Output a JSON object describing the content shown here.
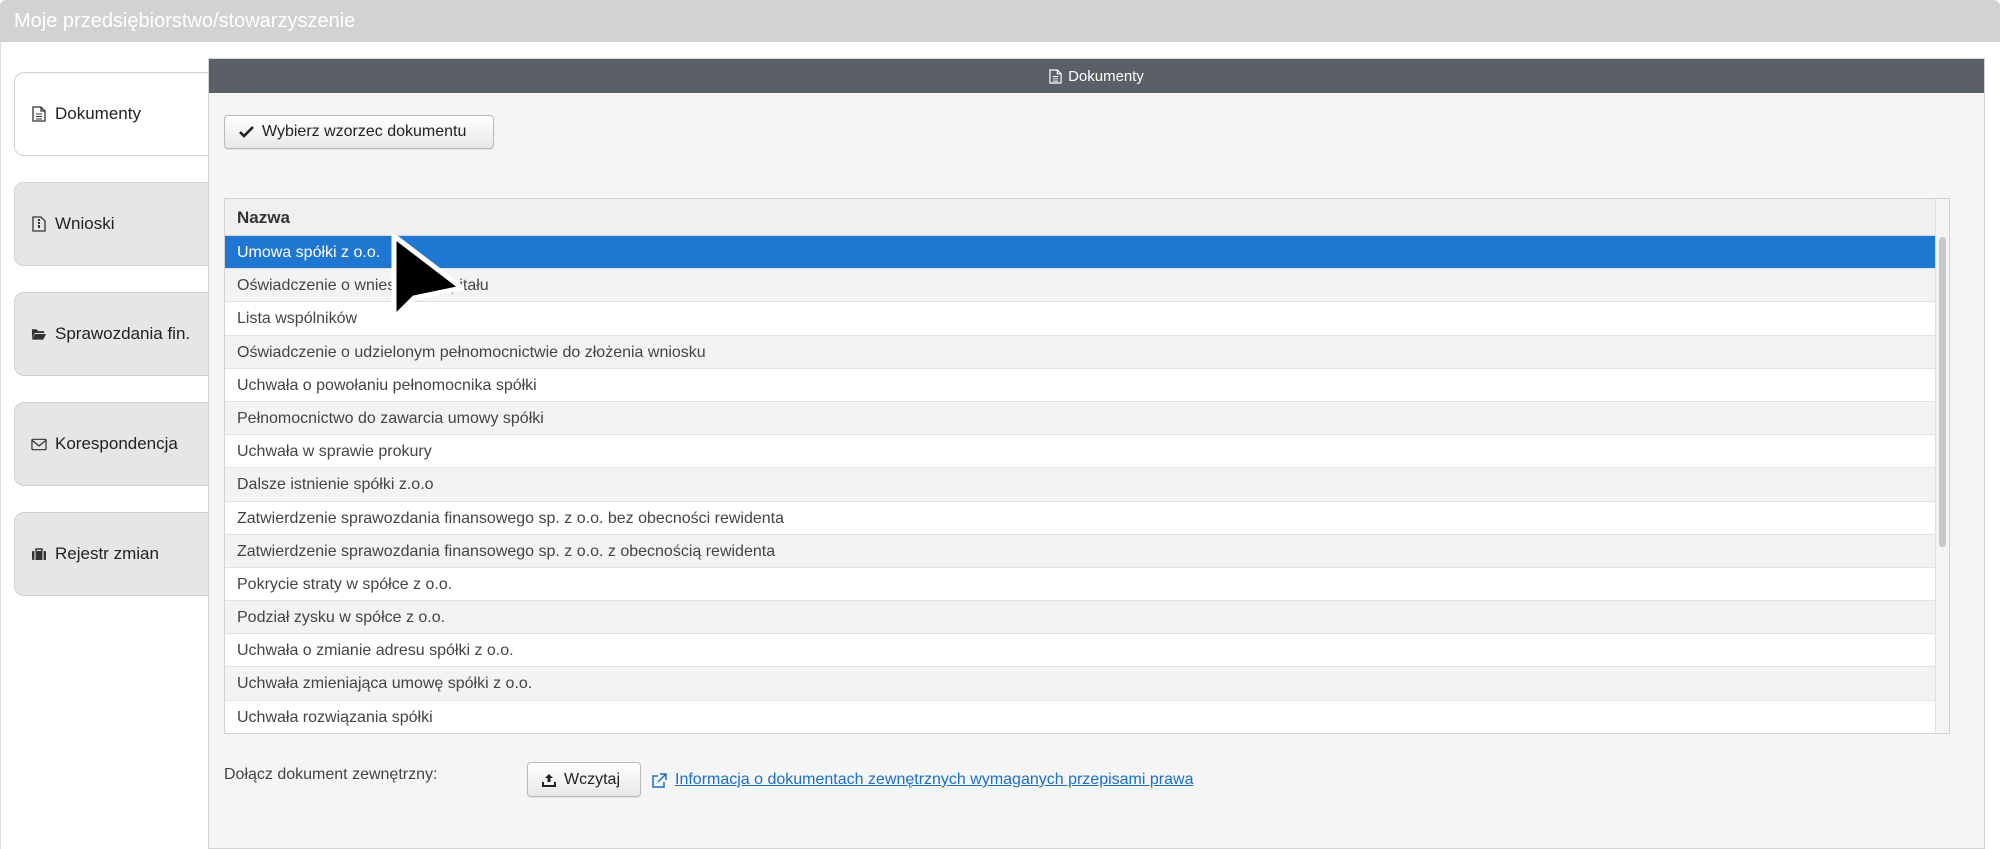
{
  "window": {
    "title": "Moje przedsiębiorstwo/stowarzyszenie"
  },
  "sidebar": {
    "tabs": [
      {
        "label": "Dokumenty",
        "icon": "file-icon",
        "active": true
      },
      {
        "label": "Wnioski",
        "icon": "file-zip-icon",
        "active": false
      },
      {
        "label": "Sprawozdania fin.",
        "icon": "folder-open-icon",
        "active": false
      },
      {
        "label": "Korespondencja",
        "icon": "envelope-icon",
        "active": false
      },
      {
        "label": "Rejestr zmian",
        "icon": "briefcase-icon",
        "active": false
      }
    ]
  },
  "panel": {
    "title": "Dokumenty",
    "choose_button": "Wybierz wzorzec dokumentu",
    "table": {
      "header": "Nazwa",
      "rows": [
        "Umowa spółki z o.o.",
        "Oświadczenie o wniesieniu kapitału",
        "Lista wspólników",
        "Oświadczenie o udzielonym pełnomocnictwie do złożenia wniosku",
        "Uchwała o powołaniu pełnomocnika spółki",
        "Pełnomocnictwo do zawarcia umowy spółki",
        "Uchwała w sprawie prokury",
        "Dalsze istnienie spółki z.o.o",
        "Zatwierdzenie sprawozdania finansowego sp. z o.o. bez obecności rewidenta",
        "Zatwierdzenie sprawozdania finansowego sp. z o.o. z obecnością rewidenta",
        "Pokrycie straty w spółce z o.o.",
        "Podział zysku w spółce z o.o.",
        "Uchwała o zmianie adresu spółki z o.o.",
        "Uchwała zmieniająca umowę spółki z o.o.",
        "Uchwała rozwiązania spółki"
      ],
      "selected_index": 0
    },
    "attach_label": "Dołącz dokument zewnętrzny:",
    "upload_button": "Wczytaj",
    "info_link": "Informacja o dokumentach zewnętrznych wymaganych przepisami prawa"
  },
  "colors": {
    "selected_row": "#1f77d2",
    "header_bar": "#5b5f67",
    "titlebar": "#d2d2d2",
    "link": "#1a6fc7"
  }
}
